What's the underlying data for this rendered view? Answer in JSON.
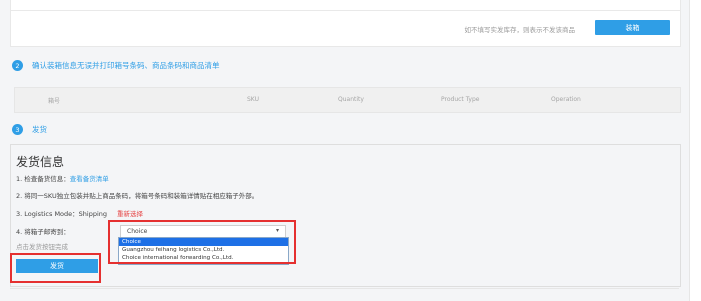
{
  "top": {
    "hint": "如不填写实发库存，则表示不发该商品",
    "pack_button": "装箱"
  },
  "step2": {
    "number": "2",
    "title": "确认装箱信息无误并打印箱号条码、商品条码和商品清单"
  },
  "table": {
    "columns": [
      "箱号",
      "SKU",
      "Quantity",
      "Product Type",
      "Operation"
    ]
  },
  "step3": {
    "number": "3",
    "title": "发货"
  },
  "shipping": {
    "title": "发货信息",
    "line1_prefix": "1. 检查备货信息：",
    "line1_link": "查看备货清单",
    "line2": "2. 将同一SKU独立包装并贴上商品条码，将箱号条码和装箱详情贴在相应箱子外部。",
    "line3_prefix": "3. Logistics Mode：Shipping",
    "line3_link": "重新选择",
    "line4_label": "4. 将箱子邮寄到：",
    "select_value": "Choice",
    "options": [
      "Choice",
      "Guangzhou feihang logistics Co.,Ltd.",
      "Choice international forwarding Co.,Ltd."
    ],
    "note": "点击发货按钮完成",
    "ship_button": "发货"
  },
  "colors": {
    "accent": "#2f9ee6",
    "highlight_box": "#e53030",
    "dropdown_selected": "#1e70e6"
  }
}
